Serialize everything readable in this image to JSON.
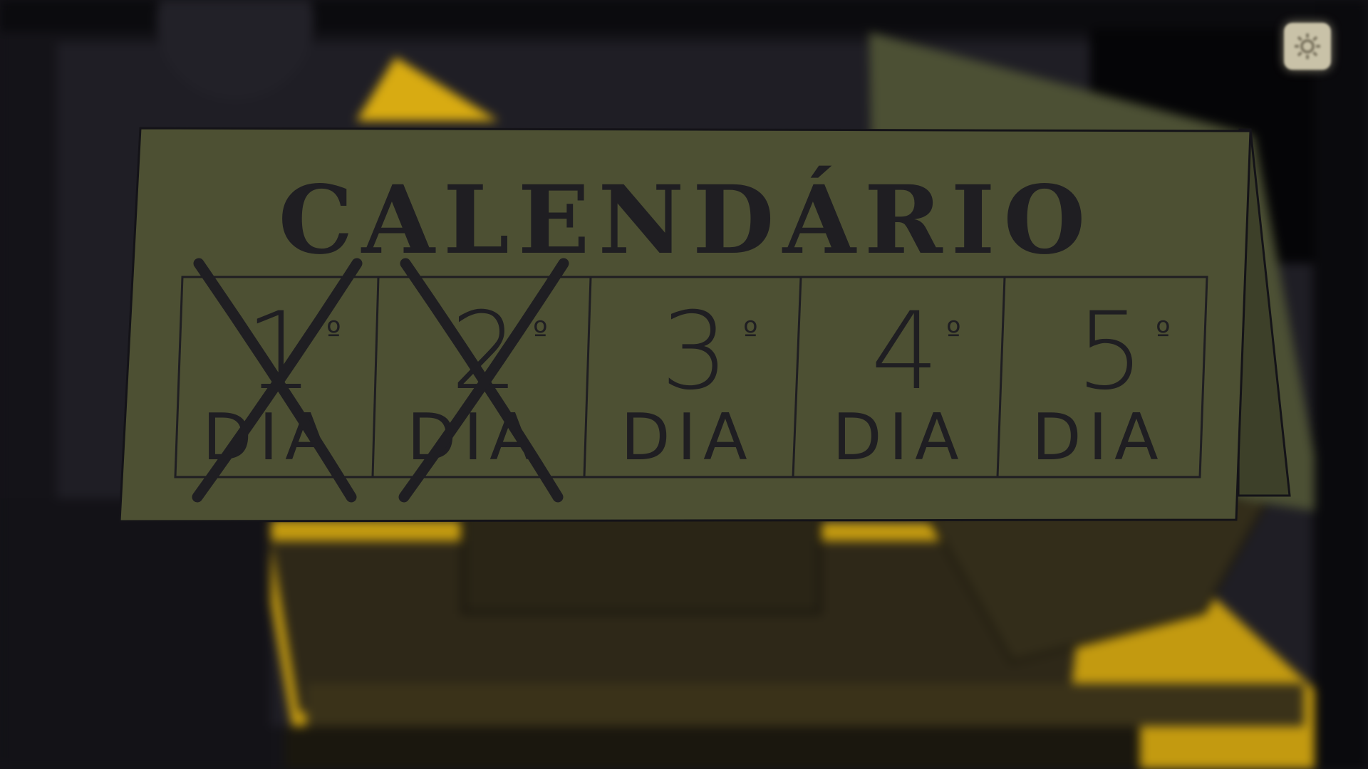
{
  "calendar": {
    "title": "CALENDÁRIO",
    "days": [
      {
        "number": "1",
        "ordinal": "º",
        "label": "DIA",
        "crossed": true
      },
      {
        "number": "2",
        "ordinal": "º",
        "label": "DIA",
        "crossed": true
      },
      {
        "number": "3",
        "ordinal": "º",
        "label": "DIA",
        "crossed": false
      },
      {
        "number": "4",
        "ordinal": "º",
        "label": "DIA",
        "crossed": false
      },
      {
        "number": "5",
        "ordinal": "º",
        "label": "DIA",
        "crossed": false
      }
    ]
  },
  "settings": {
    "icon": "gear-icon"
  },
  "colors": {
    "calendar_card": "#4d5033",
    "calendar_side": "#3d4029",
    "ink": "#1f1e22",
    "background_dark": "#141318",
    "accent_yellow": "#e5b714"
  }
}
